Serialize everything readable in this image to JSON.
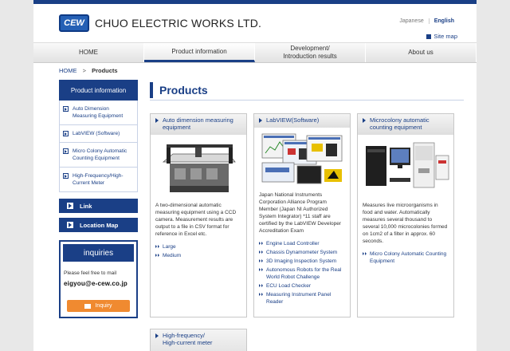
{
  "header": {
    "logo_mark": "CEW",
    "company_name": "CHUO ELECTRIC WORKS LTD.",
    "languages": [
      "Japanese",
      "English"
    ],
    "active_language": "English",
    "site_map": "Site map"
  },
  "nav": [
    {
      "label": "HOME"
    },
    {
      "label": "Product information"
    },
    {
      "label": "Development/\nIntroduction results"
    },
    {
      "label": "About us"
    }
  ],
  "breadcrumb": {
    "home": "HOME",
    "separator": ">",
    "current": "Products"
  },
  "sidebar": {
    "heading": "Product information",
    "items": [
      {
        "label": "Auto Dimension Measuring Equipment"
      },
      {
        "label": "LabVIEW (Software)"
      },
      {
        "label": "Micro Colony Automatic Counting Equipment"
      },
      {
        "label": "High-Frequency/High-Current Meter"
      }
    ],
    "link_button": "Link",
    "location_button": "Location Map",
    "inquiries": {
      "heading": "inquiries",
      "text": "Please feel free to mail",
      "email": "eigyou@e-cew.co.jp",
      "button": "Inquiry"
    }
  },
  "main": {
    "title": "Products",
    "cards": [
      {
        "title": "Auto dimension measuring equipment",
        "description": "A two-dimensional automatic measuring equipment using a CCD camera. Measurement results are output to a file in CSV format for reference in Excel etc.",
        "links": [
          "Large",
          "Medium"
        ]
      },
      {
        "title": "LabVIEW(Software)",
        "description": "Japan National Instruments Corporation Alliance Program Member (Japan NI Authorized System Integrator) *11 staff are certified by the LabVIEW Developer Accreditation Exam",
        "links": [
          "Engine Load Controller",
          "Chassis Dynamometer System",
          "3D Imaging Inspection System",
          "Autonomous Robots for the Real World Robot Challenge",
          "ECU Load Checker",
          "Measuring Instrument Panel Reader"
        ]
      },
      {
        "title": "Microcolony automatic counting equipment",
        "description": "Measures live microorganisms in food and water. Automatically measures several thousand to several 10,000 microcolonies formed on 1cm2 of a filter in approx. 60 seconds.",
        "links": [
          "Micro Colony Automatic Counting Equipment"
        ]
      },
      {
        "title": "High-frequency/\nHigh-current meter",
        "description": "",
        "links": []
      }
    ]
  },
  "colors": {
    "brand": "#1a3f86",
    "accent": "#f08a30"
  }
}
